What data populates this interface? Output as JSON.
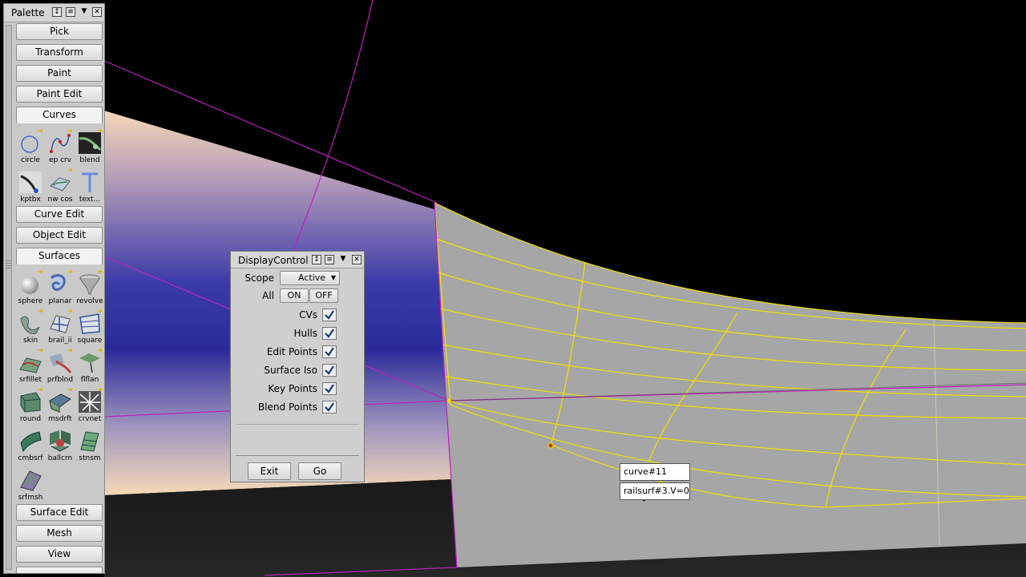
{
  "palette": {
    "title": "Palette",
    "sections": {
      "pick": "Pick",
      "transform": "Transform",
      "paint": "Paint",
      "paint_edit": "Paint Edit",
      "curves": "Curves",
      "curve_edit": "Curve Edit",
      "object_edit": "Object Edit",
      "surfaces": "Surfaces",
      "surface_edit": "Surface Edit",
      "mesh": "Mesh",
      "view": "View"
    },
    "curve_tools": {
      "circle": "circle",
      "ep_crv": "ep crv",
      "blend": "blend",
      "kptbx": "kptbx",
      "nw_cos": "nw cos",
      "text": "text..."
    },
    "surface_tools": {
      "sphere": "sphere",
      "planar": "planar",
      "revolve": "revolve",
      "skin": "skin",
      "brail_ii": "brail_ii",
      "square": "square",
      "srfillet": "srfillet",
      "prfblnd": "prfblnd",
      "flflan": "flflan",
      "round": "round",
      "msdrft": "msdrft",
      "crvnet": "crvnet",
      "cmbsrf": "cmbsrf",
      "ballcrn": "ballcrn",
      "stnsm": "stnsm",
      "srfmsh": "srfmsh"
    }
  },
  "display_control": {
    "title": "DisplayControl",
    "scope_label": "Scope",
    "scope_value": "Active",
    "all_label": "All",
    "on_label": "ON",
    "off_label": "OFF",
    "options": {
      "cvs": "CVs",
      "hulls": "Hulls",
      "edit_points": "Edit Points",
      "surface_iso": "Surface Iso",
      "key_points": "Key Points",
      "blend_points": "Blend Points"
    },
    "exit_label": "Exit",
    "go_label": "Go"
  },
  "tooltip": {
    "line1": "curve#11",
    "line2": "railsurf#3.V=0"
  },
  "colors": {
    "accent_magenta": "#c020c0",
    "curve_yellow": "#f0e000",
    "surface_gray": "#a6a6a6"
  }
}
